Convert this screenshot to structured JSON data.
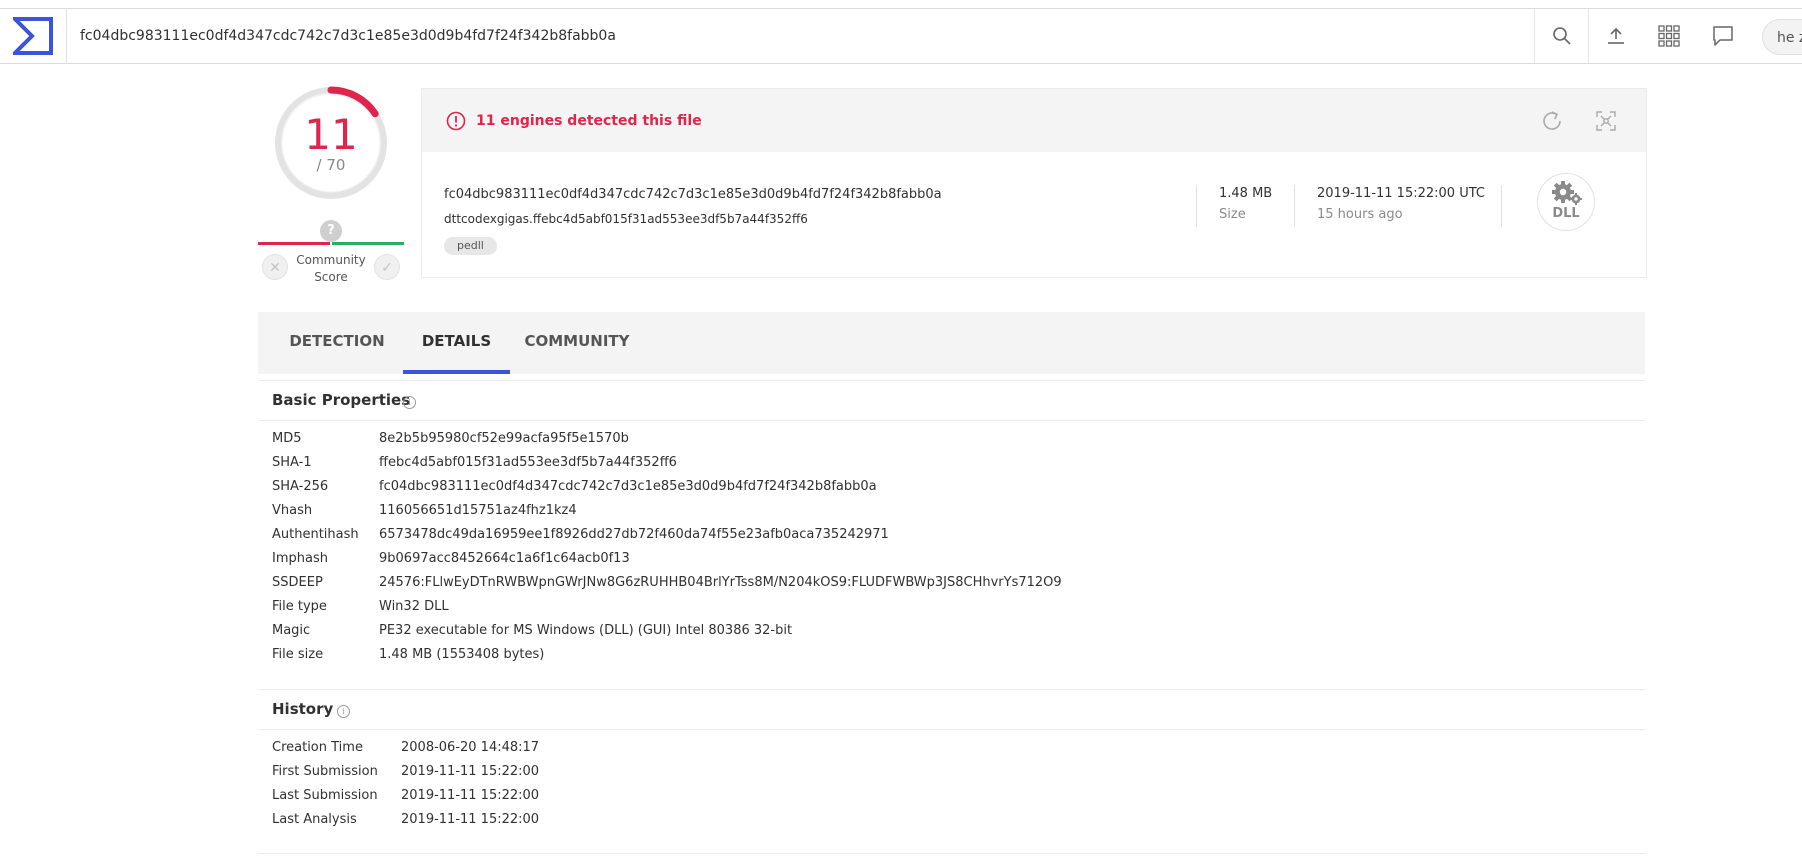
{
  "header": {
    "search_value": "fc04dbc983111ec0df4d347cdc742c7d3c1e85e3d0d9b4fd7f24f342b8fabb0a",
    "user_label": "he z"
  },
  "score": {
    "detections": "11",
    "total": "/ 70",
    "detection_ratio": 0.157,
    "community_label": "Community Score",
    "question": "?"
  },
  "summary": {
    "alert": "11 engines detected this file",
    "hash": "fc04dbc983111ec0df4d347cdc742c7d3c1e85e3d0d9b4fd7f24f342b8fabb0a",
    "filename": "dttcodexgigas.ffebc4d5abf015f31ad553ee3df5b7a44f352ff6",
    "tag": "pedll",
    "size_value": "1.48 MB",
    "size_label": "Size",
    "date_value": "2019-11-11 15:22:00 UTC",
    "date_relative": "15 hours ago",
    "file_type_icon": "DLL"
  },
  "tabs": [
    "DETECTION",
    "DETAILS",
    "COMMUNITY"
  ],
  "basic_properties": {
    "title": "Basic Properties",
    "rows": [
      {
        "key": "MD5",
        "value": "8e2b5b95980cf52e99acfa95f5e1570b"
      },
      {
        "key": "SHA-1",
        "value": "ffebc4d5abf015f31ad553ee3df5b7a44f352ff6"
      },
      {
        "key": "SHA-256",
        "value": "fc04dbc983111ec0df4d347cdc742c7d3c1e85e3d0d9b4fd7f24f342b8fabb0a"
      },
      {
        "key": "Vhash",
        "value": "116056651d15751az4fhz1kz4"
      },
      {
        "key": "Authentihash",
        "value": "6573478dc49da16959ee1f8926dd27db72f460da74f55e23afb0aca735242971"
      },
      {
        "key": "Imphash",
        "value": "9b0697acc8452664c1a6f1c64acb0f13"
      },
      {
        "key": "SSDEEP",
        "value": "24576:FLlwEyDTnRWBWpnGWrJNw8G6zRUHHB04BrlYrTss8M/N204kOS9:FLUDFWBWp3JS8CHhvrYs712O9"
      },
      {
        "key": "File type",
        "value": "Win32 DLL"
      },
      {
        "key": "Magic",
        "value": "PE32 executable for MS Windows (DLL) (GUI) Intel 80386 32-bit"
      },
      {
        "key": "File size",
        "value": "1.48 MB (1553408 bytes)"
      }
    ]
  },
  "history": {
    "title": "History",
    "rows": [
      {
        "key": "Creation Time",
        "value": "2008-06-20 14:48:17"
      },
      {
        "key": "First Submission",
        "value": "2019-11-11 15:22:00"
      },
      {
        "key": "Last Submission",
        "value": "2019-11-11 15:22:00"
      },
      {
        "key": "Last Analysis",
        "value": "2019-11-11 15:22:00"
      }
    ]
  },
  "colors": {
    "accent": "#3b54d9",
    "danger": "#e0244c",
    "success": "#27ae60"
  }
}
